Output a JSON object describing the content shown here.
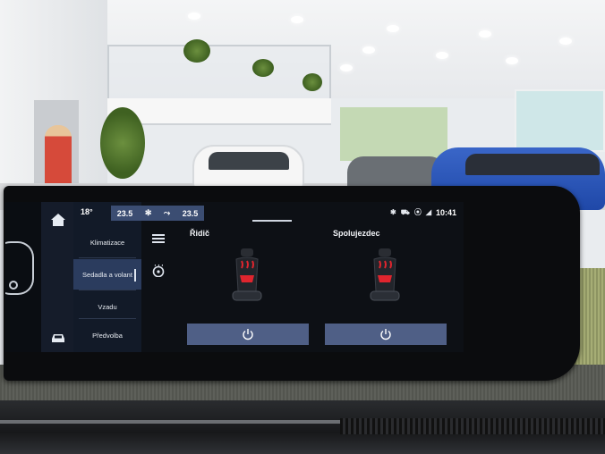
{
  "status_bar": {
    "outside_temp": "18°",
    "temp_left": "23.5",
    "temp_right": "23.5",
    "clock": "10:41"
  },
  "menu": {
    "items": [
      {
        "label": "Klimatizace"
      },
      {
        "label": "Sedadla a volant"
      },
      {
        "label": "Vzadu"
      },
      {
        "label": "Předvolba"
      }
    ]
  },
  "seats": {
    "driver_label": "Řidič",
    "passenger_label": "Spolujezdec"
  },
  "colors": {
    "accent": "#4f5f86",
    "seat_heat": "#e0252e",
    "active_menu": "#2b3c5e"
  },
  "icons": [
    "home-icon",
    "car-icon",
    "menu-icon",
    "steering-wheel-heat-icon",
    "fan-icon",
    "bluetooth-icon",
    "power-icon"
  ]
}
